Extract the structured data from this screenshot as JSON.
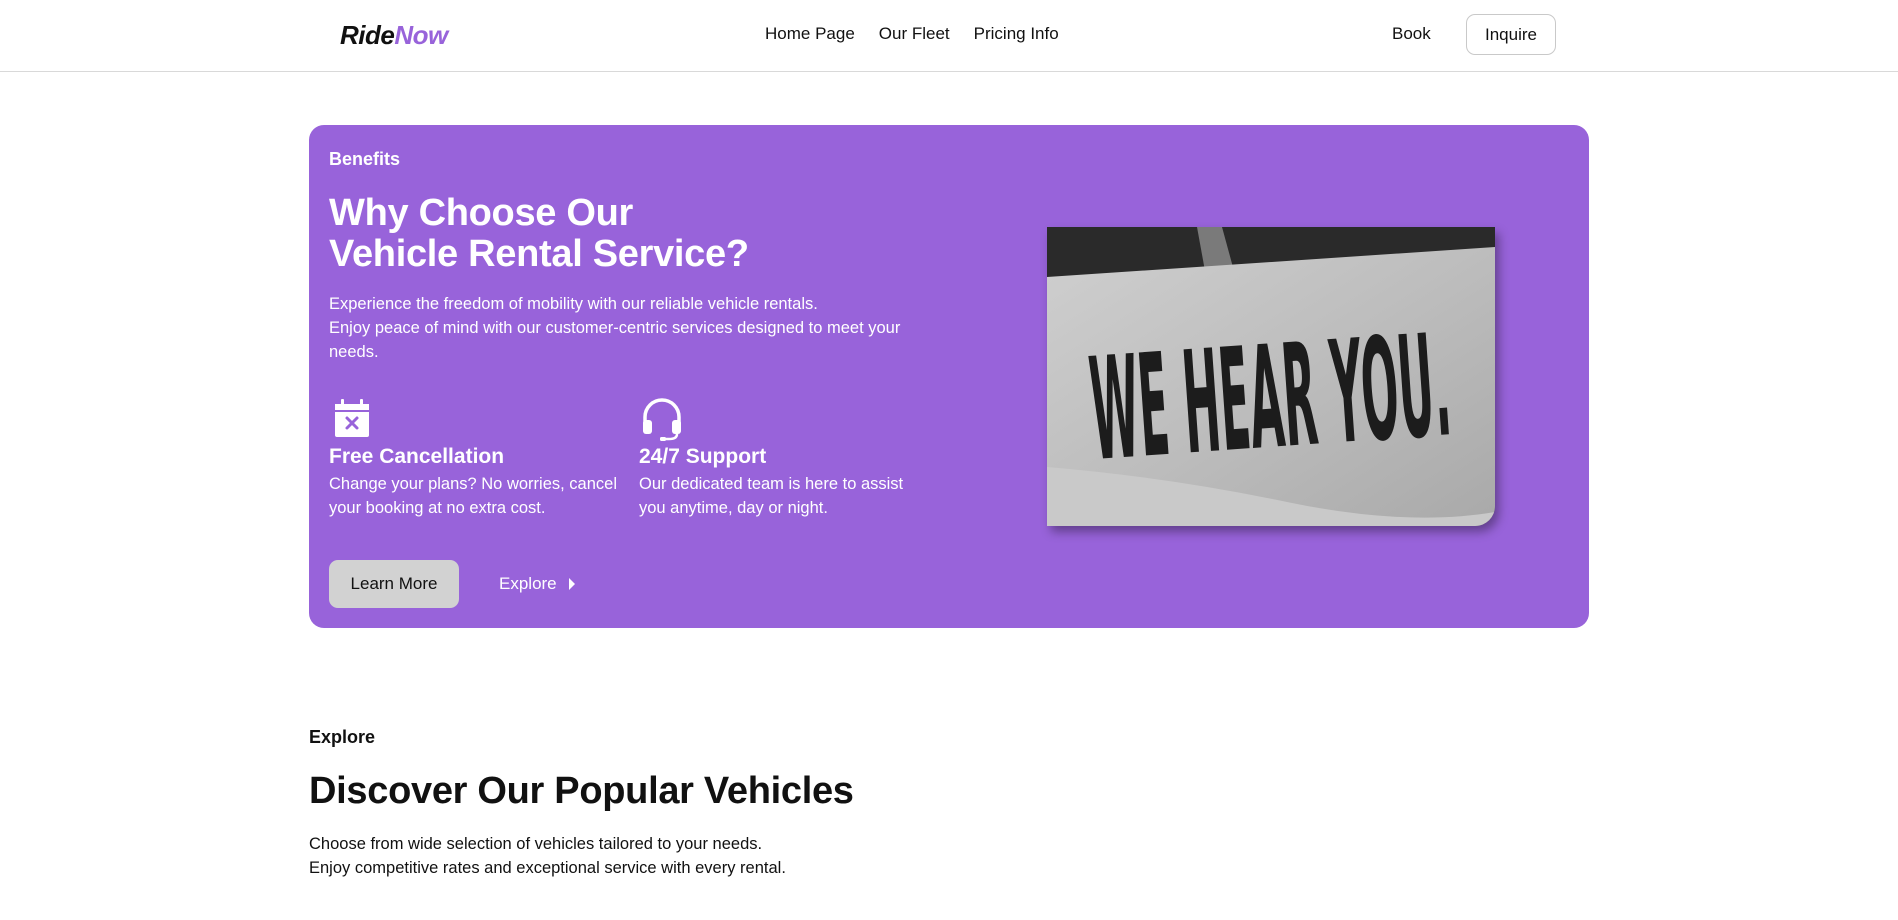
{
  "nav": {
    "logo_part1": "Ride",
    "logo_part2": "Now",
    "links": [
      "Home Page",
      "Our Fleet",
      "Pricing Info"
    ],
    "book": "Book",
    "inquire": "Inquire"
  },
  "hero": {
    "eyebrow": "Benefits",
    "title_line1": "Why Choose Our",
    "title_line2": "Vehicle Rental Service?",
    "desc_line1": "Experience the freedom of mobility with our reliable vehicle rentals.",
    "desc_line2": "Enjoy peace of mind with our customer-centric services designed to meet your needs.",
    "features": [
      {
        "icon": "calendar-x-icon",
        "title": "Free Cancellation",
        "text": "Change your plans? No worries, cancel your booking at no extra cost."
      },
      {
        "icon": "headset-icon",
        "title": "24/7 Support",
        "text": "Our dedicated team is here to assist you anytime, day or night."
      }
    ],
    "learn_more": "Learn More",
    "explore": "Explore",
    "image_text": "WE HEAR YOU."
  },
  "section": {
    "eyebrow": "Explore",
    "title": "Discover Our Popular Vehicles",
    "desc_line1": "Choose from wide selection of vehicles tailored to your needs.",
    "desc_line2": "Enjoy competitive rates and exceptional service with every rental."
  },
  "colors": {
    "accent": "#9863da",
    "button_gray": "#d2d2d2"
  }
}
